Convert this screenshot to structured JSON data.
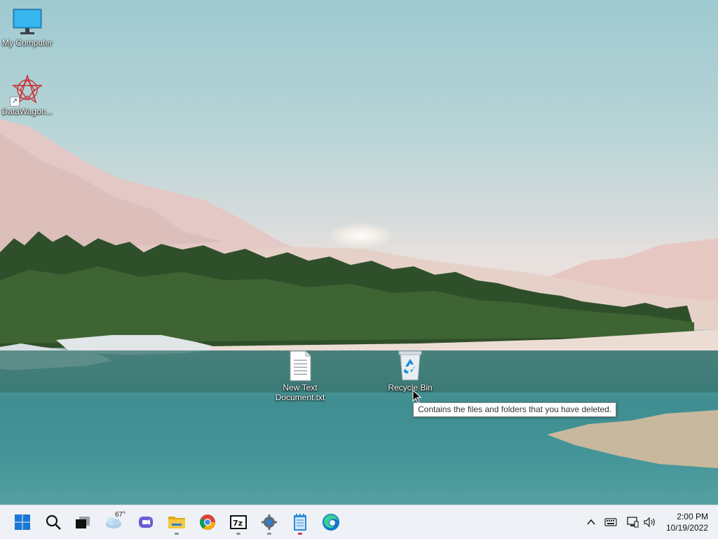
{
  "desktop": {
    "icons": [
      {
        "label": "My Computer",
        "icon": "monitor-icon"
      },
      {
        "label": "DataWagon...",
        "icon": "datawagon-icon",
        "shortcut": true
      },
      {
        "label": "New Text Document.txt",
        "label_line1": "New Text",
        "label_line2": "Document.txt",
        "icon": "text-document-icon"
      },
      {
        "label": "Recycle Bin",
        "icon": "recycle-bin-icon"
      }
    ],
    "tooltip": "Contains the files and folders that you have deleted."
  },
  "taskbar": {
    "buttons": [
      {
        "name": "start",
        "icon": "windows-logo-icon"
      },
      {
        "name": "search",
        "icon": "search-icon"
      },
      {
        "name": "task-view",
        "icon": "task-view-icon"
      },
      {
        "name": "widgets",
        "icon": "weather-icon"
      },
      {
        "name": "chat",
        "icon": "teams-chat-icon"
      },
      {
        "name": "file-explorer",
        "icon": "folder-icon"
      },
      {
        "name": "chrome",
        "icon": "chrome-icon"
      },
      {
        "name": "7zip",
        "icon": "7zip-icon"
      },
      {
        "name": "settings",
        "icon": "gear-icon"
      },
      {
        "name": "notepad",
        "icon": "notepad-icon"
      },
      {
        "name": "edge",
        "icon": "edge-icon"
      }
    ],
    "weather_temp": "67°",
    "tray": {
      "icons": [
        "chevron-up-icon",
        "keyboard-icon",
        "network-icon",
        "volume-icon"
      ],
      "time": "2:00 PM",
      "date": "10/19/2022"
    }
  },
  "colors": {
    "taskbar_bg": "#eef1f5",
    "accent": "#0067c0"
  }
}
